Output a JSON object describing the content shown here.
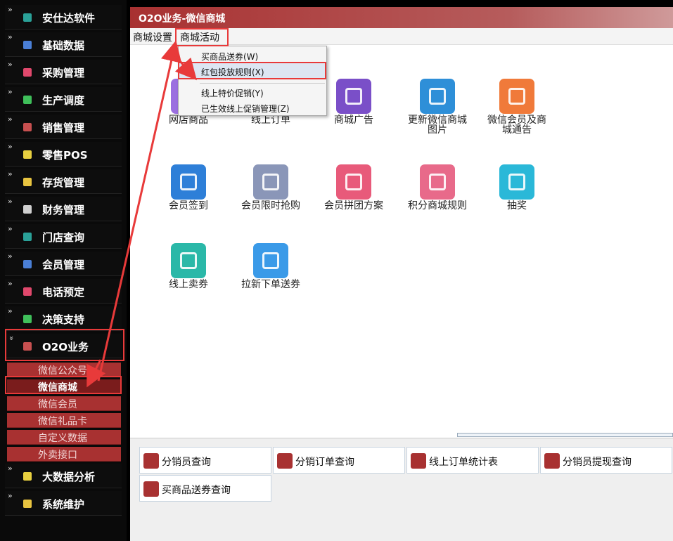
{
  "colors": {
    "accent": "#a83131",
    "highlight": "#e83a3a",
    "sidebar_bg": "#0a0a0a"
  },
  "sidebar": {
    "items": [
      {
        "label": "安仕达软件",
        "icon": "teal-app-icon",
        "color": "#2aa198"
      },
      {
        "label": "基础数据",
        "icon": "blue-app-icon",
        "color": "#4a7fd6"
      },
      {
        "label": "采购管理",
        "icon": "pink-app-icon",
        "color": "#e0486c"
      },
      {
        "label": "生产调度",
        "icon": "green-app-icon",
        "color": "#3fbf5a"
      },
      {
        "label": "销售管理",
        "icon": "red-app-icon",
        "color": "#c75050"
      },
      {
        "label": "零售POS",
        "icon": "yellow-app-icon",
        "color": "#e8d040"
      },
      {
        "label": "存货管理",
        "icon": "yellow-app-icon",
        "color": "#e8c440"
      },
      {
        "label": "财务管理",
        "icon": "gray-app-icon",
        "color": "#cfcfcf"
      },
      {
        "label": "门店查询",
        "icon": "teal-app-icon",
        "color": "#2aa198"
      },
      {
        "label": "会员管理",
        "icon": "blue-app-icon",
        "color": "#4a7fd6"
      },
      {
        "label": "电话预定",
        "icon": "pink-app-icon",
        "color": "#e0486c"
      },
      {
        "label": "决策支持",
        "icon": "green-app-icon",
        "color": "#3fbf5a"
      },
      {
        "label": "O2O业务",
        "icon": "red-app-icon",
        "color": "#c75050"
      },
      {
        "label": "大数据分析",
        "icon": "yellow-app-icon",
        "color": "#e8d040"
      },
      {
        "label": "系统维护",
        "icon": "yellow-app-icon",
        "color": "#e8c440"
      }
    ],
    "chevron": "»",
    "chevron_open": "»",
    "sub_items": [
      "微信公众号",
      "微信商城",
      "微信会员",
      "微信礼品卡",
      "自定义数据",
      "外卖接口"
    ]
  },
  "main": {
    "title": "O2O业务-微信商城",
    "menu": [
      "商城设置",
      "商城活动"
    ],
    "dropdown": [
      "买商品送券(W)",
      "红包投放规则(X)",
      "线上特价促销(Y)",
      "已生效线上促销管理(Z)"
    ],
    "tiles": [
      {
        "label": "网店商品",
        "icon": "purple-app-icon",
        "color": "#9b6fe0"
      },
      {
        "label": "线上订单",
        "icon": "order-icon",
        "color": "#5a8de0"
      },
      {
        "label": "商城广告",
        "icon": "org-chart-icon",
        "color": "#7a4fc8"
      },
      {
        "label": "更新微信商城图片",
        "icon": "monitor-icon",
        "color": "#2e8fd8"
      },
      {
        "label": "微信会员及商城通告",
        "icon": "notice-icon",
        "color": "#f07a3a"
      },
      {
        "label": "会员签到",
        "icon": "id-card-icon",
        "color": "#2e7fd8"
      },
      {
        "label": "会员限时抢购",
        "icon": "clock-window-icon",
        "color": "#8a96b8"
      },
      {
        "label": "会员拼团方案",
        "icon": "document-user-icon",
        "color": "#e85a7a"
      },
      {
        "label": "积分商城规则",
        "icon": "abc-blocks-icon",
        "color": "#e86a8a"
      },
      {
        "label": "抽奖",
        "icon": "search-chart-icon",
        "color": "#2ab8d8"
      },
      {
        "label": "线上卖券",
        "icon": "grid-edit-icon",
        "color": "#2ab8a8"
      },
      {
        "label": "拉新下单送券",
        "icon": "users-icon",
        "color": "#3a9ae8"
      }
    ],
    "quick": [
      {
        "label": "分销员查询",
        "icon": "search-box-icon"
      },
      {
        "label": "分销订单查询",
        "icon": "heart-icon"
      },
      {
        "label": "线上订单统计表",
        "icon": "receipt-icon"
      },
      {
        "label": "分销员提现查询",
        "icon": "search-icon"
      },
      {
        "label": "买商品送券查询",
        "icon": "bar-chart-icon"
      }
    ]
  }
}
